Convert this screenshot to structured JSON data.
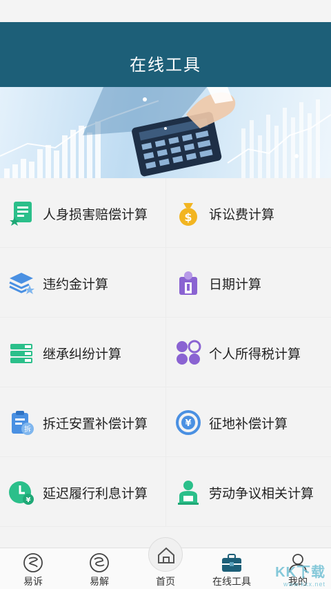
{
  "header": {
    "title": "在线工具"
  },
  "tools": [
    {
      "label": "人身损害赔偿计算",
      "icon": "document-star-icon"
    },
    {
      "label": "诉讼费计算",
      "icon": "money-bag-icon"
    },
    {
      "label": "违约金计算",
      "icon": "layers-star-icon"
    },
    {
      "label": "日期计算",
      "icon": "calendar-person-icon"
    },
    {
      "label": "继承纠纷计算",
      "icon": "book-stack-icon"
    },
    {
      "label": "个人所得税计算",
      "icon": "flower-grid-icon"
    },
    {
      "label": "拆迁安置补偿计算",
      "icon": "clipboard-demolish-icon"
    },
    {
      "label": "征地补偿计算",
      "icon": "yen-coin-icon"
    },
    {
      "label": "延迟履行利息计算",
      "icon": "clock-yen-icon"
    },
    {
      "label": "劳动争议相关计算",
      "icon": "worker-icon"
    }
  ],
  "tabbar": [
    {
      "label": "易诉",
      "icon": "yisu-icon"
    },
    {
      "label": "易解",
      "icon": "yijie-icon"
    },
    {
      "label": "首页",
      "icon": "home-icon"
    },
    {
      "label": "在线工具",
      "icon": "toolbox-icon"
    },
    {
      "label": "我的",
      "icon": "user-icon"
    }
  ],
  "watermark": {
    "text": "KK下载",
    "sub": "www.kkx.net"
  },
  "colors": {
    "header": "#1d5f78",
    "green": "#2bbf8a",
    "yellow": "#f2b521",
    "blue": "#4a90e2",
    "purple": "#8a63d2"
  }
}
